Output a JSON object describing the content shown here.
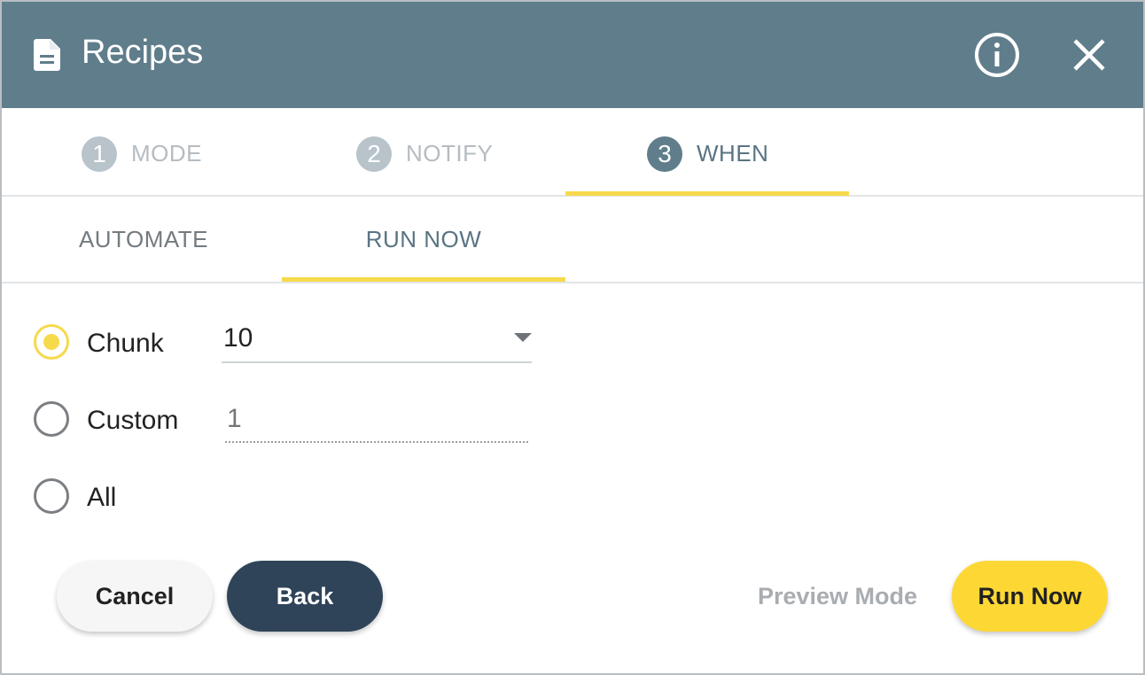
{
  "header": {
    "title": "Recipes",
    "icons": {
      "title": "document-icon",
      "info": "info-icon",
      "close": "close-icon"
    }
  },
  "stepper": {
    "steps": [
      {
        "number": "1",
        "label": "MODE",
        "active": false
      },
      {
        "number": "2",
        "label": "NOTIFY",
        "active": false
      },
      {
        "number": "3",
        "label": "WHEN",
        "active": true
      }
    ]
  },
  "tabs": [
    {
      "label": "AUTOMATE",
      "active": false
    },
    {
      "label": "RUN NOW",
      "active": true
    }
  ],
  "options": {
    "chunk": {
      "label": "Chunk",
      "selected": true,
      "value": "10"
    },
    "custom": {
      "label": "Custom",
      "selected": false,
      "placeholder": "1"
    },
    "all": {
      "label": "All",
      "selected": false
    }
  },
  "footer": {
    "cancel_label": "Cancel",
    "back_label": "Back",
    "preview_label": "Preview Mode",
    "run_label": "Run Now"
  },
  "colors": {
    "header_bg": "#607d8b",
    "accent_yellow": "#fdd835",
    "back_button": "#2f4459"
  }
}
